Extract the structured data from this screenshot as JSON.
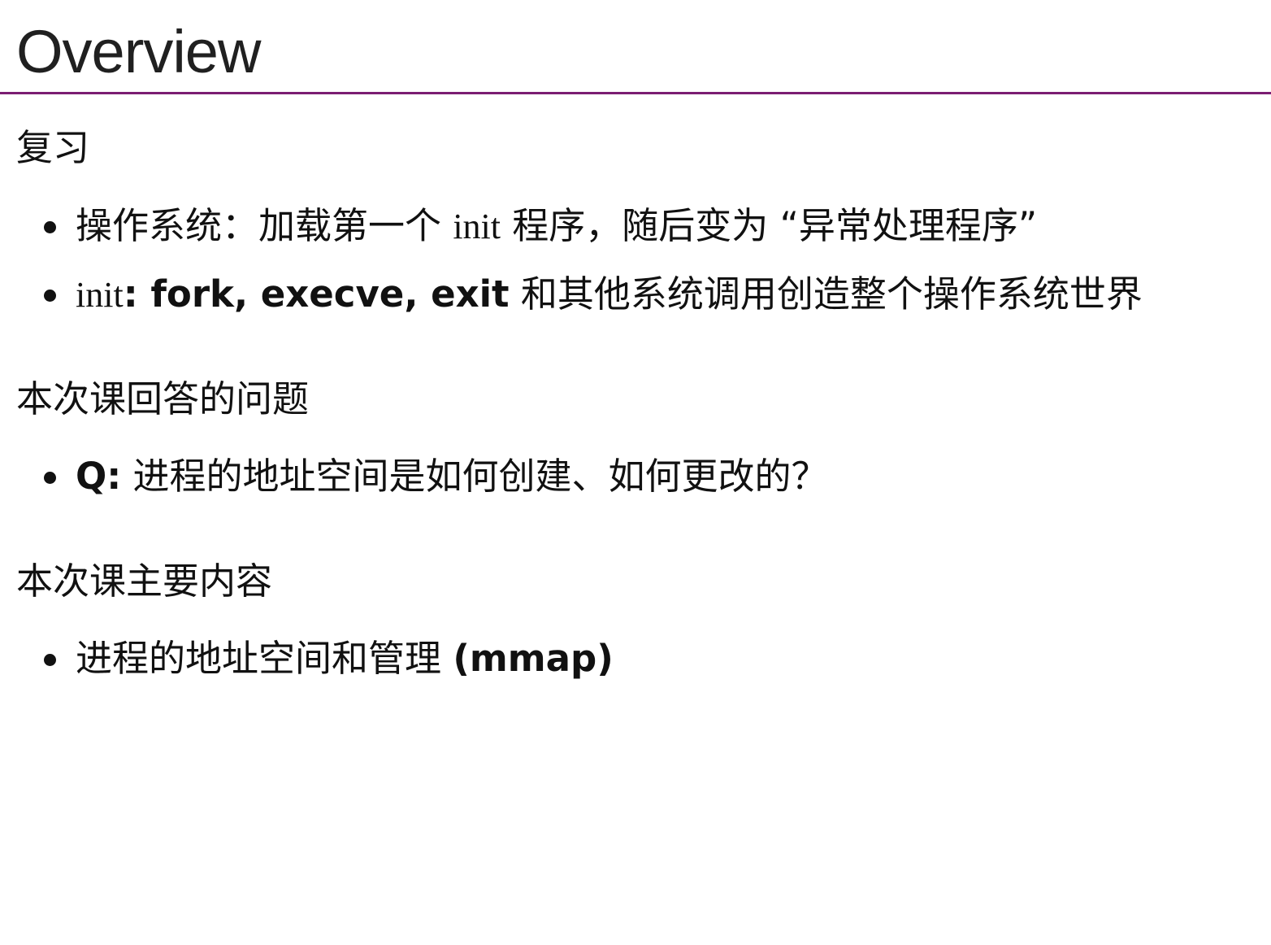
{
  "slide": {
    "title": "Overview",
    "accent_color": "#7b1d72",
    "sections": [
      {
        "heading": "复习",
        "items": [
          {
            "segments": [
              {
                "text": "操作系统：加载第一个 ",
                "style": "normal"
              },
              {
                "text": "init",
                "style": "code"
              },
              {
                "text": " 程序，随后变为 “异常处理程序”",
                "style": "normal"
              }
            ]
          },
          {
            "segments": [
              {
                "text": "init",
                "style": "code"
              },
              {
                "text": ": fork, execve, exit",
                "style": "strong"
              },
              {
                "text": " 和其他系统调用创造整个操作系统世界",
                "style": "normal"
              }
            ]
          }
        ]
      },
      {
        "heading": "本次课回答的问题",
        "items": [
          {
            "segments": [
              {
                "text": "Q:",
                "style": "strong"
              },
              {
                "text": " 进程的地址空间是如何创建、如何更改的？",
                "style": "normal"
              }
            ]
          }
        ]
      },
      {
        "heading": "本次课主要内容",
        "items": [
          {
            "segments": [
              {
                "text": "进程的地址空间和管理 ",
                "style": "normal"
              },
              {
                "text": "(mmap)",
                "style": "strong"
              }
            ]
          }
        ]
      }
    ]
  }
}
